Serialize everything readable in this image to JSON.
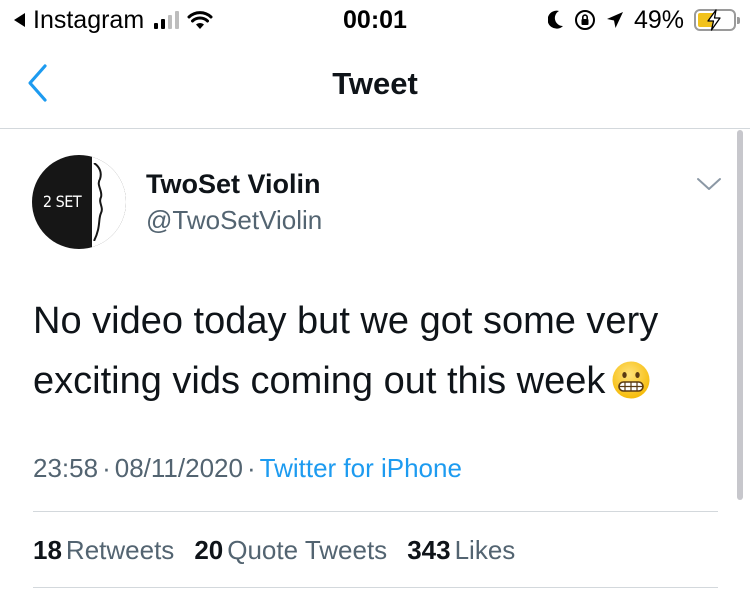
{
  "status_bar": {
    "back_app": "Instagram",
    "time": "00:01",
    "battery_percent": "49%",
    "battery_level": 0.49,
    "icons": [
      "back-triangle-icon",
      "signal-icon",
      "wifi-icon",
      "moon-icon",
      "orientation-lock-icon",
      "location-icon",
      "battery-charging-icon"
    ]
  },
  "nav": {
    "title": "Tweet",
    "back_icon": "chevron-left-icon"
  },
  "tweet": {
    "author": {
      "name": "TwoSet Violin",
      "handle": "@TwoSetViolin",
      "avatar_text": "2 SET"
    },
    "text": "No video today but we got some very exciting vids coming out this week",
    "emoji": "grimacing-face",
    "time": "23:58",
    "date": "08/11/2020",
    "source": "Twitter for iPhone",
    "stats": {
      "retweets_count": "18",
      "retweets_label": "Retweets",
      "quotes_count": "20",
      "quotes_label": "Quote Tweets",
      "likes_count": "343",
      "likes_label": "Likes"
    }
  },
  "colors": {
    "link": "#1d9bf0",
    "secondary_text": "#536471",
    "primary_text": "#0f1419",
    "battery_fill": "#f2c21b"
  }
}
